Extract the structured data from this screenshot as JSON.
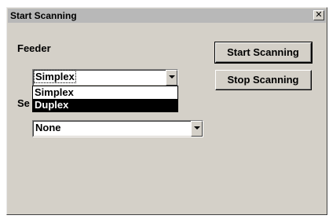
{
  "window": {
    "title": "Start Scanning",
    "close_glyph": "✕"
  },
  "feeder": {
    "label": "Feeder",
    "selected": "Simplex",
    "options": [
      "Simplex",
      "Duplex"
    ],
    "highlighted": "Duplex"
  },
  "second": {
    "label_partial": "Se",
    "selected": "None"
  },
  "buttons": {
    "start": "Start Scanning",
    "stop": "Stop Scanning"
  },
  "colors": {
    "dialog_bg": "#d4d0c8",
    "titlebar_bg": "#b8b8b8",
    "highlight_bg": "#000000",
    "highlight_fg": "#ffffff"
  }
}
